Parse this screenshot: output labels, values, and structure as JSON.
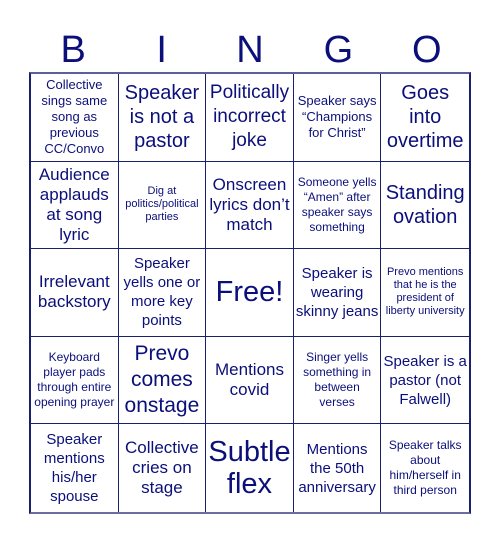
{
  "header": {
    "letters": [
      "B",
      "I",
      "N",
      "G",
      "O"
    ]
  },
  "board": {
    "cells": [
      "Collective sings same song as previous CC/Convo",
      "Speaker is not a pastor",
      "Politically incorrect joke",
      "Speaker says “Champions for Christ”",
      "Goes into overtime",
      "Audience applauds at song lyric",
      "Dig at politics/political parties",
      "Onscreen lyrics don’t match",
      "Someone yells “Amen” after speaker says something",
      "Standing ovation",
      "Irrelevant backstory",
      "Speaker yells one or more key points",
      "Free!",
      "Speaker is wearing skinny jeans",
      "Prevo mentions that he is the president of liberty university",
      "Keyboard player pads through entire opening prayer",
      "Prevo comes onstage",
      "Mentions covid",
      "Singer yells something in between verses",
      "Speaker is a pastor (not Falwell)",
      "Speaker mentions his/her spouse",
      "Collective cries on stage",
      "Subtle flex",
      "Mentions the 50th anniversary",
      "Speaker talks about him/herself in third person"
    ]
  },
  "colors": {
    "text": "#0b0f7a",
    "border": "#1b1f6e",
    "background": "#ffffff"
  }
}
